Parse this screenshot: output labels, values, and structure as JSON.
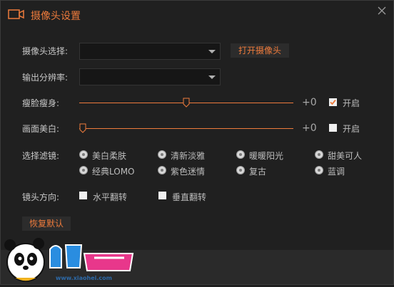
{
  "window": {
    "title": "摄像头设置"
  },
  "camera": {
    "label": "摄像头选择:",
    "selected": "",
    "open_button": "打开摄像头"
  },
  "resolution": {
    "label": "输出分辨率:",
    "selected": ""
  },
  "slim": {
    "label": "瘦脸瘦身:",
    "value_text": "+0",
    "value": 0.5,
    "enable_label": "开启",
    "enabled": true
  },
  "beauty": {
    "label": "画面美白:",
    "value_text": "+0",
    "value": 0.0,
    "enable_label": "开启",
    "enabled": false
  },
  "filters": {
    "label": "选择滤镜:",
    "options": [
      "美白柔肤",
      "清新淡雅",
      "暖暖阳光",
      "甜美可人",
      "经典LOMO",
      "紫色迷情",
      "复古",
      "蓝调"
    ]
  },
  "mirror": {
    "label": "镜头方向:",
    "horizontal": "水平翻转",
    "vertical": "垂直翻转"
  },
  "reset_button": "恢复默认",
  "watermark": {
    "text": "www.xiaohei.com"
  },
  "colors": {
    "accent": "#ee7b3c",
    "background": "#202020"
  }
}
